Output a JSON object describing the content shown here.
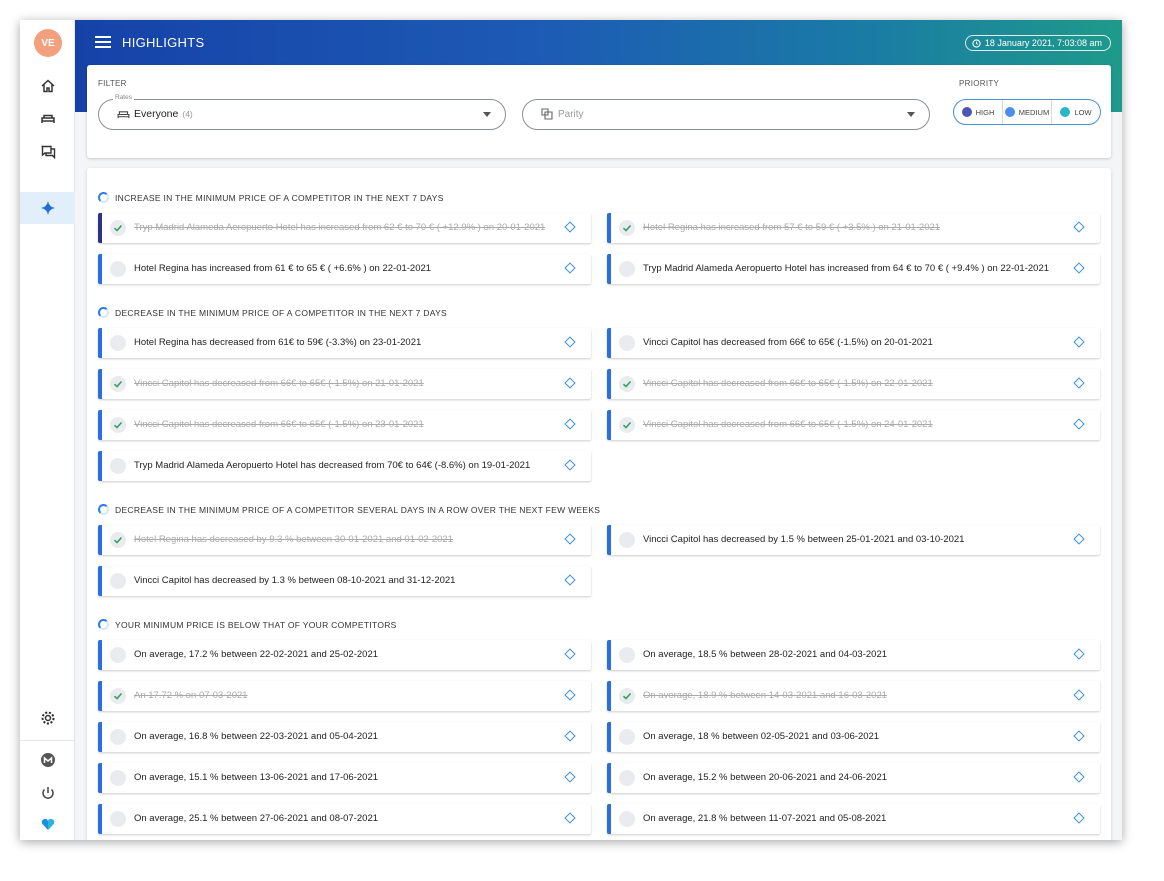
{
  "sidebar": {
    "avatar_initials": "VE",
    "items": [
      {
        "name": "home-icon"
      },
      {
        "name": "bed-icon"
      },
      {
        "name": "chat-icon"
      },
      {
        "name": "sparkle-icon",
        "active": true
      }
    ],
    "bottom": [
      {
        "name": "settings-icon"
      },
      {
        "name": "m-logo-icon"
      },
      {
        "name": "power-icon"
      },
      {
        "name": "heart-logo-icon"
      }
    ]
  },
  "header": {
    "title": "HIGHLIGHTS",
    "datetime": "18 January 2021, 7:03:08 am"
  },
  "filter": {
    "label": "FILTER",
    "rates_legend": "Rates",
    "rates_value": "Everyone",
    "rates_count": "(4)",
    "parity_placeholder": "Parity",
    "priority_label": "PRIORITY",
    "priority_options": [
      {
        "label": "HIGH",
        "color": "#4a55b8"
      },
      {
        "label": "MEDIUM",
        "color": "#4a8fe8"
      },
      {
        "label": "LOW",
        "color": "#2bb5c9"
      }
    ]
  },
  "sections": [
    {
      "title": "INCREASE IN THE MINIMUM PRICE OF A COMPETITOR IN THE NEXT 7 DAYS",
      "items": [
        {
          "text": "Tryp Madrid Alameda Aeropuerto Hotel has increased from 62 € to 70 € ( +12.9% ) on 20-01-2021",
          "done": true,
          "priority": "high"
        },
        {
          "text": "Hotel Regina has increased from 57 € to 59 € ( +3.5% ) on 21-01-2021",
          "done": true,
          "priority": "medium"
        },
        {
          "text": "Hotel Regina has increased from 61 € to 65 € ( +6.6% ) on 22-01-2021",
          "done": false,
          "priority": "medium"
        },
        {
          "text": "Tryp Madrid Alameda Aeropuerto Hotel has increased from 64 € to 70 € ( +9.4% ) on 22-01-2021",
          "done": false,
          "priority": "medium"
        }
      ]
    },
    {
      "title": "DECREASE IN THE MINIMUM PRICE OF A COMPETITOR IN THE NEXT 7 DAYS",
      "items": [
        {
          "text": "Hotel Regina has decreased from 61€ to 59€ (-3.3%) on 23-01-2021",
          "done": false,
          "priority": "medium"
        },
        {
          "text": "Vincci Capitol has decreased from 66€ to 65€ (-1.5%) on 20-01-2021",
          "done": false,
          "priority": "medium"
        },
        {
          "text": "Vincci Capitol has decreased from 66€ to 65€ (-1.5%) on 21-01-2021",
          "done": true,
          "priority": "medium"
        },
        {
          "text": "Vincci Capitol has decreased from 66€ to 65€ (-1.5%) on 22-01-2021",
          "done": true,
          "priority": "medium"
        },
        {
          "text": "Vincci Capitol has decreased from 66€ to 65€ (-1.5%) on 23-01-2021",
          "done": true,
          "priority": "medium"
        },
        {
          "text": "Vincci Capitol has decreased from 66€ to 65€ (-1.5%) on 24-01-2021",
          "done": true,
          "priority": "medium"
        },
        {
          "text": "Tryp Madrid Alameda Aeropuerto Hotel has decreased from 70€ to 64€ (-8.6%) on 19-01-2021",
          "done": false,
          "priority": "medium"
        }
      ]
    },
    {
      "title": "DECREASE IN THE MINIMUM PRICE OF A COMPETITOR SEVERAL DAYS IN A ROW OVER THE NEXT FEW WEEKS",
      "items": [
        {
          "text": "Hotel Regina has decreased by 9.3 % between 30-01-2021 and 01-02-2021",
          "done": true,
          "priority": "medium"
        },
        {
          "text": "Vincci Capitol has decreased by 1.5 % between 25-01-2021 and 03-10-2021",
          "done": false,
          "priority": "medium"
        },
        {
          "text": "Vincci Capitol has decreased by 1.3 % between 08-10-2021 and 31-12-2021",
          "done": false,
          "priority": "medium"
        }
      ]
    },
    {
      "title": "YOUR MINIMUM PRICE IS BELOW THAT OF YOUR COMPETITORS",
      "items": [
        {
          "text": "On average, 17.2 % between 22-02-2021 and 25-02-2021",
          "done": false,
          "priority": "medium"
        },
        {
          "text": "On average, 18.5 % between 28-02-2021 and 04-03-2021",
          "done": false,
          "priority": "medium"
        },
        {
          "text": "An 17.72 % on 07-03-2021",
          "done": true,
          "priority": "medium"
        },
        {
          "text": "On average, 18.9 % between 14-03-2021 and 16-03-2021",
          "done": true,
          "priority": "medium"
        },
        {
          "text": "On average, 16.8 % between 22-03-2021 and 05-04-2021",
          "done": false,
          "priority": "medium"
        },
        {
          "text": "On average, 18 % between 02-05-2021 and 03-06-2021",
          "done": false,
          "priority": "medium"
        },
        {
          "text": "On average, 15.1 % between 13-06-2021 and 17-06-2021",
          "done": false,
          "priority": "medium"
        },
        {
          "text": "On average, 15.2 % between 20-06-2021 and 24-06-2021",
          "done": false,
          "priority": "medium"
        },
        {
          "text": "On average, 25.1 % between 27-06-2021 and 08-07-2021",
          "done": false,
          "priority": "medium"
        },
        {
          "text": "On average, 21.8 % between 11-07-2021 and 05-08-2021",
          "done": false,
          "priority": "medium"
        }
      ]
    }
  ]
}
